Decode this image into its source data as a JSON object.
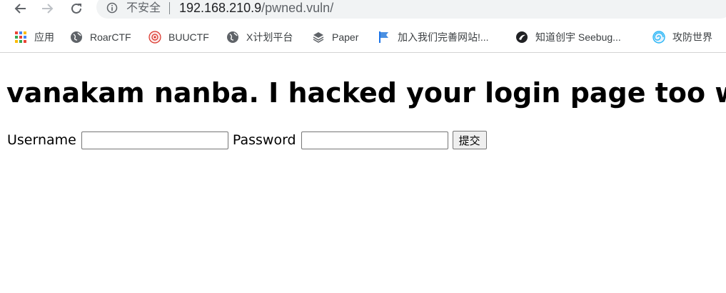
{
  "browser": {
    "security_label": "不安全",
    "url_host": "192.168.210.9",
    "url_path": "/pwned.vuln/"
  },
  "bookmarks": [
    {
      "label": "应用",
      "icon": "apps-grid-icon"
    },
    {
      "label": "RoarCTF",
      "icon": "globe-icon"
    },
    {
      "label": "BUUCTF",
      "icon": "buuctf-logo-icon"
    },
    {
      "label": "X计划平台",
      "icon": "globe-icon"
    },
    {
      "label": "Paper",
      "icon": "layers-icon"
    },
    {
      "label": "加入我们完善网站!...",
      "icon": "flag-icon"
    },
    {
      "label": "知道创宇 Seebug...",
      "icon": "seebug-logo-icon"
    },
    {
      "label": "攻防世界",
      "icon": "spiral-logo-icon"
    }
  ],
  "page": {
    "headline": "vanakam nanba. I hacked your login page too with",
    "username_label": "Username",
    "password_label": "Password",
    "submit_label": "提交",
    "username_value": "",
    "password_value": ""
  },
  "colors": {
    "omnibox_bg": "#f1f3f4",
    "headline": "#000000"
  }
}
